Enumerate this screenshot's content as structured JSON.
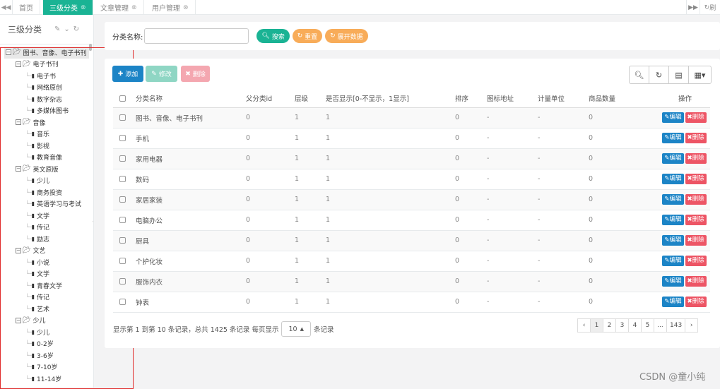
{
  "tabs": [
    {
      "label": "首页",
      "closable": false,
      "active": false
    },
    {
      "label": "三级分类",
      "closable": true,
      "active": true
    },
    {
      "label": "文章管理",
      "closable": true,
      "active": false
    },
    {
      "label": "用户管理",
      "closable": true,
      "active": false
    }
  ],
  "tab_right_label": "刷",
  "sidebar": {
    "title": "三级分类",
    "tree": [
      {
        "label": "图书、音像、电子书刊",
        "level": 0,
        "folder": true,
        "toggle": "-"
      },
      {
        "label": "电子书刊",
        "level": 1,
        "folder": true,
        "toggle": "-"
      },
      {
        "label": "电子书",
        "level": 2,
        "folder": false
      },
      {
        "label": "网络原创",
        "level": 2,
        "folder": false
      },
      {
        "label": "数字杂志",
        "level": 2,
        "folder": false
      },
      {
        "label": "多媒体图书",
        "level": 2,
        "folder": false
      },
      {
        "label": "音像",
        "level": 1,
        "folder": true,
        "toggle": "-"
      },
      {
        "label": "音乐",
        "level": 2,
        "folder": false
      },
      {
        "label": "影视",
        "level": 2,
        "folder": false
      },
      {
        "label": "教育音像",
        "level": 2,
        "folder": false
      },
      {
        "label": "英文原版",
        "level": 1,
        "folder": true,
        "toggle": "-"
      },
      {
        "label": "少儿",
        "level": 2,
        "folder": false
      },
      {
        "label": "商务投资",
        "level": 2,
        "folder": false
      },
      {
        "label": "英语学习与考试",
        "level": 2,
        "folder": false
      },
      {
        "label": "文学",
        "level": 2,
        "folder": false
      },
      {
        "label": "传记",
        "level": 2,
        "folder": false
      },
      {
        "label": "励志",
        "level": 2,
        "folder": false
      },
      {
        "label": "文艺",
        "level": 1,
        "folder": true,
        "toggle": "-"
      },
      {
        "label": "小说",
        "level": 2,
        "folder": false
      },
      {
        "label": "文学",
        "level": 2,
        "folder": false
      },
      {
        "label": "青春文学",
        "level": 2,
        "folder": false
      },
      {
        "label": "传记",
        "level": 2,
        "folder": false
      },
      {
        "label": "艺术",
        "level": 2,
        "folder": false
      },
      {
        "label": "少儿",
        "level": 1,
        "folder": true,
        "toggle": "-"
      },
      {
        "label": "少儿",
        "level": 2,
        "folder": false
      },
      {
        "label": "0-2岁",
        "level": 2,
        "folder": false
      },
      {
        "label": "3-6岁",
        "level": 2,
        "folder": false
      },
      {
        "label": "7-10岁",
        "level": 2,
        "folder": false
      },
      {
        "label": "11-14岁",
        "level": 2,
        "folder": false
      }
    ]
  },
  "search": {
    "label": "分类名称:",
    "value": "",
    "buttons": {
      "search": "搜索",
      "reset": "重置",
      "expand": "展开数据"
    }
  },
  "toolbar": {
    "add": "添加",
    "edit": "修改",
    "delete": "删除"
  },
  "table": {
    "columns": [
      "分类名称",
      "父分类id",
      "层级",
      "是否显示[0-不显示，1显示]",
      "排序",
      "图标地址",
      "计量单位",
      "商品数量",
      "操作"
    ],
    "rows": [
      [
        "图书、音像、电子书刊",
        "0",
        "1",
        "1",
        "0",
        "-",
        "-",
        "0"
      ],
      [
        "手机",
        "0",
        "1",
        "1",
        "0",
        "-",
        "-",
        "0"
      ],
      [
        "家用电器",
        "0",
        "1",
        "1",
        "0",
        "-",
        "-",
        "0"
      ],
      [
        "数码",
        "0",
        "1",
        "1",
        "0",
        "-",
        "-",
        "0"
      ],
      [
        "家居家装",
        "0",
        "1",
        "1",
        "0",
        "-",
        "-",
        "0"
      ],
      [
        "电脑办公",
        "0",
        "1",
        "1",
        "0",
        "-",
        "-",
        "0"
      ],
      [
        "厨具",
        "0",
        "1",
        "1",
        "0",
        "-",
        "-",
        "0"
      ],
      [
        "个护化妆",
        "0",
        "1",
        "1",
        "0",
        "-",
        "-",
        "0"
      ],
      [
        "服饰内衣",
        "0",
        "1",
        "1",
        "0",
        "-",
        "-",
        "0"
      ],
      [
        "钟表",
        "0",
        "1",
        "1",
        "0",
        "-",
        "-",
        "0"
      ]
    ],
    "row_actions": {
      "edit": "编辑",
      "delete": "删除"
    }
  },
  "pagination": {
    "info": "显示第 1 到第 10 条记录，总共 1425 条记录",
    "per_page_label": "每页显示",
    "per_page_value": "10",
    "records_label": "条记录",
    "pages": [
      "‹",
      "1",
      "2",
      "3",
      "4",
      "5",
      "...",
      "143",
      "›"
    ],
    "active_page": "1"
  },
  "watermark": "CSDN @童小纯"
}
